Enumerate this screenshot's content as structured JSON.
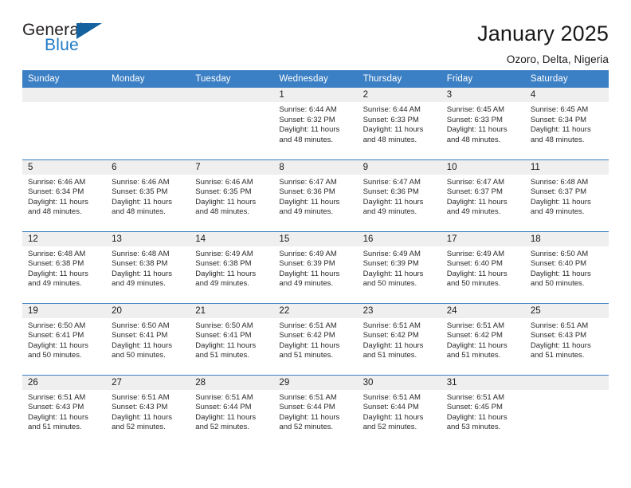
{
  "logo": {
    "word_top": "General",
    "word_bottom": "Blue",
    "accent_color": "#1f7ac4"
  },
  "header": {
    "title": "January 2025",
    "subtitle": "Ozoro, Delta, Nigeria"
  },
  "calendar": {
    "header_bg": "#3b7fc4",
    "daynum_bg": "#efefef",
    "weekdays": [
      "Sunday",
      "Monday",
      "Tuesday",
      "Wednesday",
      "Thursday",
      "Friday",
      "Saturday"
    ],
    "weeks": [
      [
        {
          "day": "",
          "sunrise": "",
          "sunset": "",
          "daylight_line1": "",
          "daylight_line2": ""
        },
        {
          "day": "",
          "sunrise": "",
          "sunset": "",
          "daylight_line1": "",
          "daylight_line2": ""
        },
        {
          "day": "",
          "sunrise": "",
          "sunset": "",
          "daylight_line1": "",
          "daylight_line2": ""
        },
        {
          "day": "1",
          "sunrise": "Sunrise: 6:44 AM",
          "sunset": "Sunset: 6:32 PM",
          "daylight_line1": "Daylight: 11 hours",
          "daylight_line2": "and 48 minutes."
        },
        {
          "day": "2",
          "sunrise": "Sunrise: 6:44 AM",
          "sunset": "Sunset: 6:33 PM",
          "daylight_line1": "Daylight: 11 hours",
          "daylight_line2": "and 48 minutes."
        },
        {
          "day": "3",
          "sunrise": "Sunrise: 6:45 AM",
          "sunset": "Sunset: 6:33 PM",
          "daylight_line1": "Daylight: 11 hours",
          "daylight_line2": "and 48 minutes."
        },
        {
          "day": "4",
          "sunrise": "Sunrise: 6:45 AM",
          "sunset": "Sunset: 6:34 PM",
          "daylight_line1": "Daylight: 11 hours",
          "daylight_line2": "and 48 minutes."
        }
      ],
      [
        {
          "day": "5",
          "sunrise": "Sunrise: 6:46 AM",
          "sunset": "Sunset: 6:34 PM",
          "daylight_line1": "Daylight: 11 hours",
          "daylight_line2": "and 48 minutes."
        },
        {
          "day": "6",
          "sunrise": "Sunrise: 6:46 AM",
          "sunset": "Sunset: 6:35 PM",
          "daylight_line1": "Daylight: 11 hours",
          "daylight_line2": "and 48 minutes."
        },
        {
          "day": "7",
          "sunrise": "Sunrise: 6:46 AM",
          "sunset": "Sunset: 6:35 PM",
          "daylight_line1": "Daylight: 11 hours",
          "daylight_line2": "and 48 minutes."
        },
        {
          "day": "8",
          "sunrise": "Sunrise: 6:47 AM",
          "sunset": "Sunset: 6:36 PM",
          "daylight_line1": "Daylight: 11 hours",
          "daylight_line2": "and 49 minutes."
        },
        {
          "day": "9",
          "sunrise": "Sunrise: 6:47 AM",
          "sunset": "Sunset: 6:36 PM",
          "daylight_line1": "Daylight: 11 hours",
          "daylight_line2": "and 49 minutes."
        },
        {
          "day": "10",
          "sunrise": "Sunrise: 6:47 AM",
          "sunset": "Sunset: 6:37 PM",
          "daylight_line1": "Daylight: 11 hours",
          "daylight_line2": "and 49 minutes."
        },
        {
          "day": "11",
          "sunrise": "Sunrise: 6:48 AM",
          "sunset": "Sunset: 6:37 PM",
          "daylight_line1": "Daylight: 11 hours",
          "daylight_line2": "and 49 minutes."
        }
      ],
      [
        {
          "day": "12",
          "sunrise": "Sunrise: 6:48 AM",
          "sunset": "Sunset: 6:38 PM",
          "daylight_line1": "Daylight: 11 hours",
          "daylight_line2": "and 49 minutes."
        },
        {
          "day": "13",
          "sunrise": "Sunrise: 6:48 AM",
          "sunset": "Sunset: 6:38 PM",
          "daylight_line1": "Daylight: 11 hours",
          "daylight_line2": "and 49 minutes."
        },
        {
          "day": "14",
          "sunrise": "Sunrise: 6:49 AM",
          "sunset": "Sunset: 6:38 PM",
          "daylight_line1": "Daylight: 11 hours",
          "daylight_line2": "and 49 minutes."
        },
        {
          "day": "15",
          "sunrise": "Sunrise: 6:49 AM",
          "sunset": "Sunset: 6:39 PM",
          "daylight_line1": "Daylight: 11 hours",
          "daylight_line2": "and 49 minutes."
        },
        {
          "day": "16",
          "sunrise": "Sunrise: 6:49 AM",
          "sunset": "Sunset: 6:39 PM",
          "daylight_line1": "Daylight: 11 hours",
          "daylight_line2": "and 50 minutes."
        },
        {
          "day": "17",
          "sunrise": "Sunrise: 6:49 AM",
          "sunset": "Sunset: 6:40 PM",
          "daylight_line1": "Daylight: 11 hours",
          "daylight_line2": "and 50 minutes."
        },
        {
          "day": "18",
          "sunrise": "Sunrise: 6:50 AM",
          "sunset": "Sunset: 6:40 PM",
          "daylight_line1": "Daylight: 11 hours",
          "daylight_line2": "and 50 minutes."
        }
      ],
      [
        {
          "day": "19",
          "sunrise": "Sunrise: 6:50 AM",
          "sunset": "Sunset: 6:41 PM",
          "daylight_line1": "Daylight: 11 hours",
          "daylight_line2": "and 50 minutes."
        },
        {
          "day": "20",
          "sunrise": "Sunrise: 6:50 AM",
          "sunset": "Sunset: 6:41 PM",
          "daylight_line1": "Daylight: 11 hours",
          "daylight_line2": "and 50 minutes."
        },
        {
          "day": "21",
          "sunrise": "Sunrise: 6:50 AM",
          "sunset": "Sunset: 6:41 PM",
          "daylight_line1": "Daylight: 11 hours",
          "daylight_line2": "and 51 minutes."
        },
        {
          "day": "22",
          "sunrise": "Sunrise: 6:51 AM",
          "sunset": "Sunset: 6:42 PM",
          "daylight_line1": "Daylight: 11 hours",
          "daylight_line2": "and 51 minutes."
        },
        {
          "day": "23",
          "sunrise": "Sunrise: 6:51 AM",
          "sunset": "Sunset: 6:42 PM",
          "daylight_line1": "Daylight: 11 hours",
          "daylight_line2": "and 51 minutes."
        },
        {
          "day": "24",
          "sunrise": "Sunrise: 6:51 AM",
          "sunset": "Sunset: 6:42 PM",
          "daylight_line1": "Daylight: 11 hours",
          "daylight_line2": "and 51 minutes."
        },
        {
          "day": "25",
          "sunrise": "Sunrise: 6:51 AM",
          "sunset": "Sunset: 6:43 PM",
          "daylight_line1": "Daylight: 11 hours",
          "daylight_line2": "and 51 minutes."
        }
      ],
      [
        {
          "day": "26",
          "sunrise": "Sunrise: 6:51 AM",
          "sunset": "Sunset: 6:43 PM",
          "daylight_line1": "Daylight: 11 hours",
          "daylight_line2": "and 51 minutes."
        },
        {
          "day": "27",
          "sunrise": "Sunrise: 6:51 AM",
          "sunset": "Sunset: 6:43 PM",
          "daylight_line1": "Daylight: 11 hours",
          "daylight_line2": "and 52 minutes."
        },
        {
          "day": "28",
          "sunrise": "Sunrise: 6:51 AM",
          "sunset": "Sunset: 6:44 PM",
          "daylight_line1": "Daylight: 11 hours",
          "daylight_line2": "and 52 minutes."
        },
        {
          "day": "29",
          "sunrise": "Sunrise: 6:51 AM",
          "sunset": "Sunset: 6:44 PM",
          "daylight_line1": "Daylight: 11 hours",
          "daylight_line2": "and 52 minutes."
        },
        {
          "day": "30",
          "sunrise": "Sunrise: 6:51 AM",
          "sunset": "Sunset: 6:44 PM",
          "daylight_line1": "Daylight: 11 hours",
          "daylight_line2": "and 52 minutes."
        },
        {
          "day": "31",
          "sunrise": "Sunrise: 6:51 AM",
          "sunset": "Sunset: 6:45 PM",
          "daylight_line1": "Daylight: 11 hours",
          "daylight_line2": "and 53 minutes."
        },
        {
          "day": "",
          "sunrise": "",
          "sunset": "",
          "daylight_line1": "",
          "daylight_line2": ""
        }
      ]
    ]
  }
}
